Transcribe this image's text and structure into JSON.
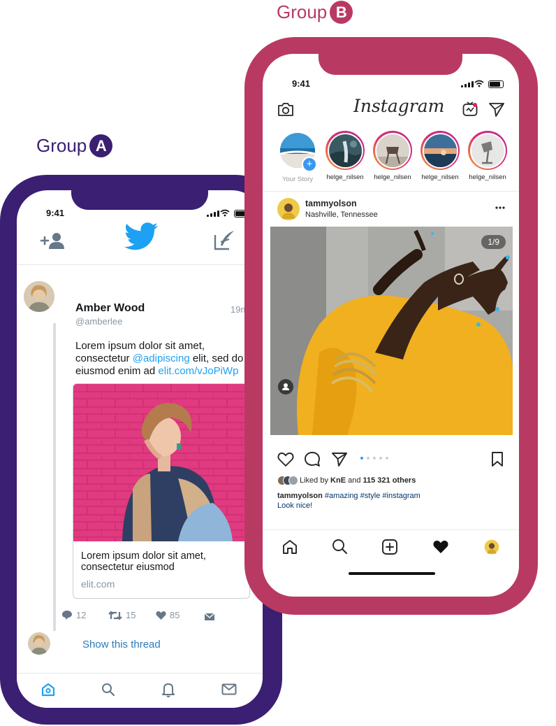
{
  "group_a": {
    "label": "Group",
    "letter": "A",
    "color": "#3a1f72"
  },
  "group_b": {
    "label": "Group",
    "letter": "B",
    "color": "#b83a63"
  },
  "twitter": {
    "status_time": "9:41",
    "brand_color": "#1da1f2",
    "header_icons": [
      "add-user-icon",
      "twitter-bird-icon",
      "compose-icon"
    ],
    "tweet": {
      "name": "Amber Wood",
      "handle": "@amberlee",
      "time": "19m",
      "text_1": "Lorem ipsum dolor sit amet, consectetur ",
      "mention": "@adipiscing",
      "text_2": " elit, sed do eiusmod enim ad ",
      "url": "elit.com/vJoPiWp",
      "card_title": "Lorem ipsum dolor sit amet, consectetur eiusmod",
      "card_domain": "elit.com",
      "replies": "12",
      "retweets": "15",
      "likes": "85"
    },
    "show_thread": "Show this thread",
    "tabs": [
      "home-icon",
      "search-icon",
      "notifications-icon",
      "messages-icon"
    ]
  },
  "instagram": {
    "status_time": "9:41",
    "logo": "Instagram",
    "stories": [
      {
        "label": "Your Story"
      },
      {
        "label": "helge_nilsen"
      },
      {
        "label": "helge_nilsen"
      },
      {
        "label": "helge_nilsen"
      },
      {
        "label": "helge_nilsen"
      }
    ],
    "post": {
      "username": "tammyolson",
      "location": "Nashville, Tennessee",
      "counter": "1/9",
      "liked_prefix": "Liked by ",
      "liked_user": "KnE",
      "liked_mid": " and ",
      "liked_count": "115 321 others",
      "caption_user": "tammyolson",
      "caption_tags": " #amazing #style #instagram",
      "caption_text": "Look nice!"
    },
    "tabs": [
      "home-icon",
      "search-icon",
      "add-post-icon",
      "heart-icon",
      "profile-avatar"
    ]
  }
}
